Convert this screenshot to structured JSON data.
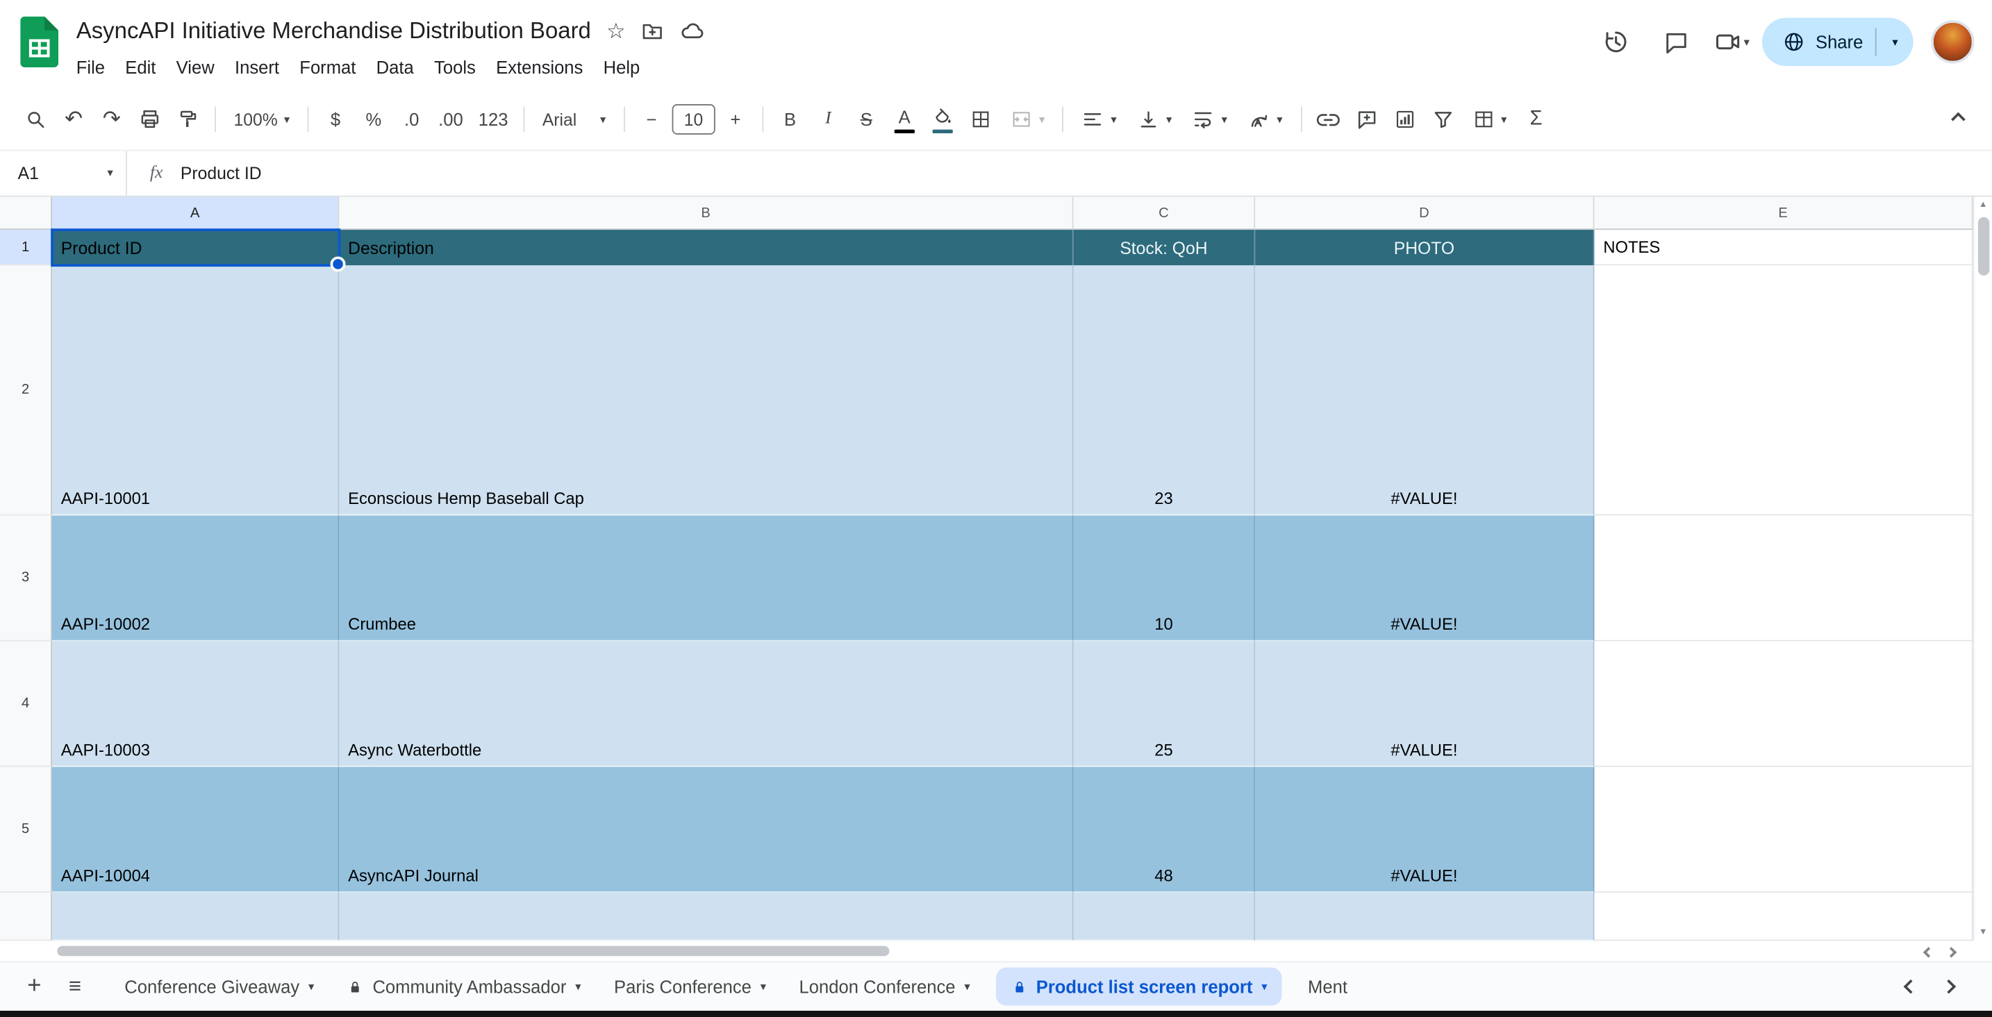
{
  "header": {
    "title": "AsyncAPI Initiative Merchandise Distribution Board",
    "menu": [
      "File",
      "Edit",
      "View",
      "Insert",
      "Format",
      "Data",
      "Tools",
      "Extensions",
      "Help"
    ],
    "share_label": "Share"
  },
  "toolbar": {
    "zoom": "100%",
    "currency": "$",
    "percent": "%",
    "decrease_decimal": ".0",
    "increase_decimal": ".00",
    "plain_number": "123",
    "font_family": "Arial",
    "font_size": "10",
    "minus": "−",
    "plus": "+",
    "bold": "B",
    "italic": "I",
    "strikethrough": "S",
    "text_color": "A",
    "functions": "Σ"
  },
  "formula_bar": {
    "name_box": "A1",
    "fx": "fx",
    "content": "Product ID"
  },
  "grid": {
    "column_headers": [
      "A",
      "B",
      "C",
      "D",
      "E"
    ],
    "row_numbers": [
      "1",
      "2",
      "3",
      "4",
      "5"
    ],
    "header_row": {
      "product_id": "Product ID",
      "description": "Description",
      "stock": "Stock: QoH",
      "photo": "PHOTO",
      "notes": "NOTES"
    },
    "rows": [
      {
        "id": "AAPI-10001",
        "description": "Econscious Hemp Baseball Cap",
        "stock": "23",
        "photo": "#VALUE!"
      },
      {
        "id": "AAPI-10002",
        "description": "Crumbee",
        "stock": "10",
        "photo": "#VALUE!"
      },
      {
        "id": "AAPI-10003",
        "description": "Async Waterbottle",
        "stock": "25",
        "photo": "#VALUE!"
      },
      {
        "id": "AAPI-10004",
        "description": "AsyncAPI Journal",
        "stock": "48",
        "photo": "#VALUE!"
      }
    ]
  },
  "sheet_tabs": [
    {
      "label": "Conference Giveaway"
    },
    {
      "label": "Community Ambassador",
      "locked": true
    },
    {
      "label": "Paris Conference"
    },
    {
      "label": "London Conference"
    },
    {
      "label": "Product list screen report",
      "locked": true,
      "active": true
    },
    {
      "label": "Ment"
    }
  ],
  "colors": {
    "accent_blue": "#0b57d0",
    "share_button_bg": "#c2e7ff",
    "table_header_fill": "#2d6b7d",
    "band_light": "#cfe1f0",
    "band_dark": "#96c2de",
    "selection_tint": "#d3e3fd",
    "logo_green": "#0f9d58"
  },
  "icons": {
    "star": "☆",
    "caret": "▾",
    "undo": "↶",
    "redo": "↷",
    "plus": "+",
    "all_sheets": "≡",
    "up": "▲",
    "down": "▼"
  }
}
